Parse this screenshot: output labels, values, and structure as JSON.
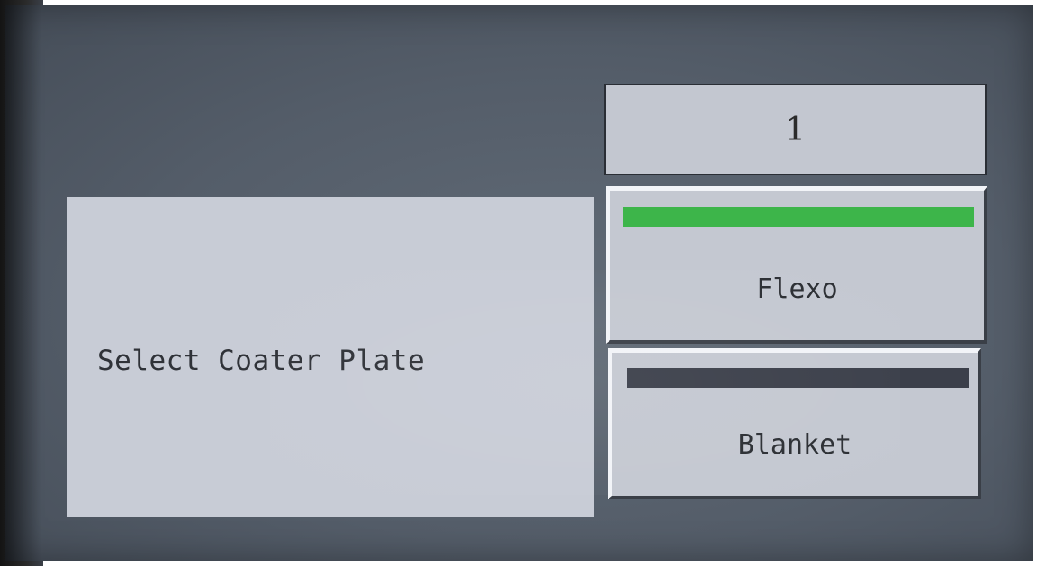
{
  "counter": {
    "value": "1"
  },
  "prompt": {
    "text": "Select Coater Plate"
  },
  "options": [
    {
      "label": "Flexo",
      "selected": true,
      "indicator_color": "#3db54a"
    },
    {
      "label": "Blanket",
      "selected": false,
      "indicator_color": "#3b3f4a"
    }
  ],
  "colors": {
    "screen_background": "#59626e",
    "panel": "#c8ccd6",
    "selected_indicator": "#3db54a",
    "unselected_indicator": "#3b3f4a"
  }
}
